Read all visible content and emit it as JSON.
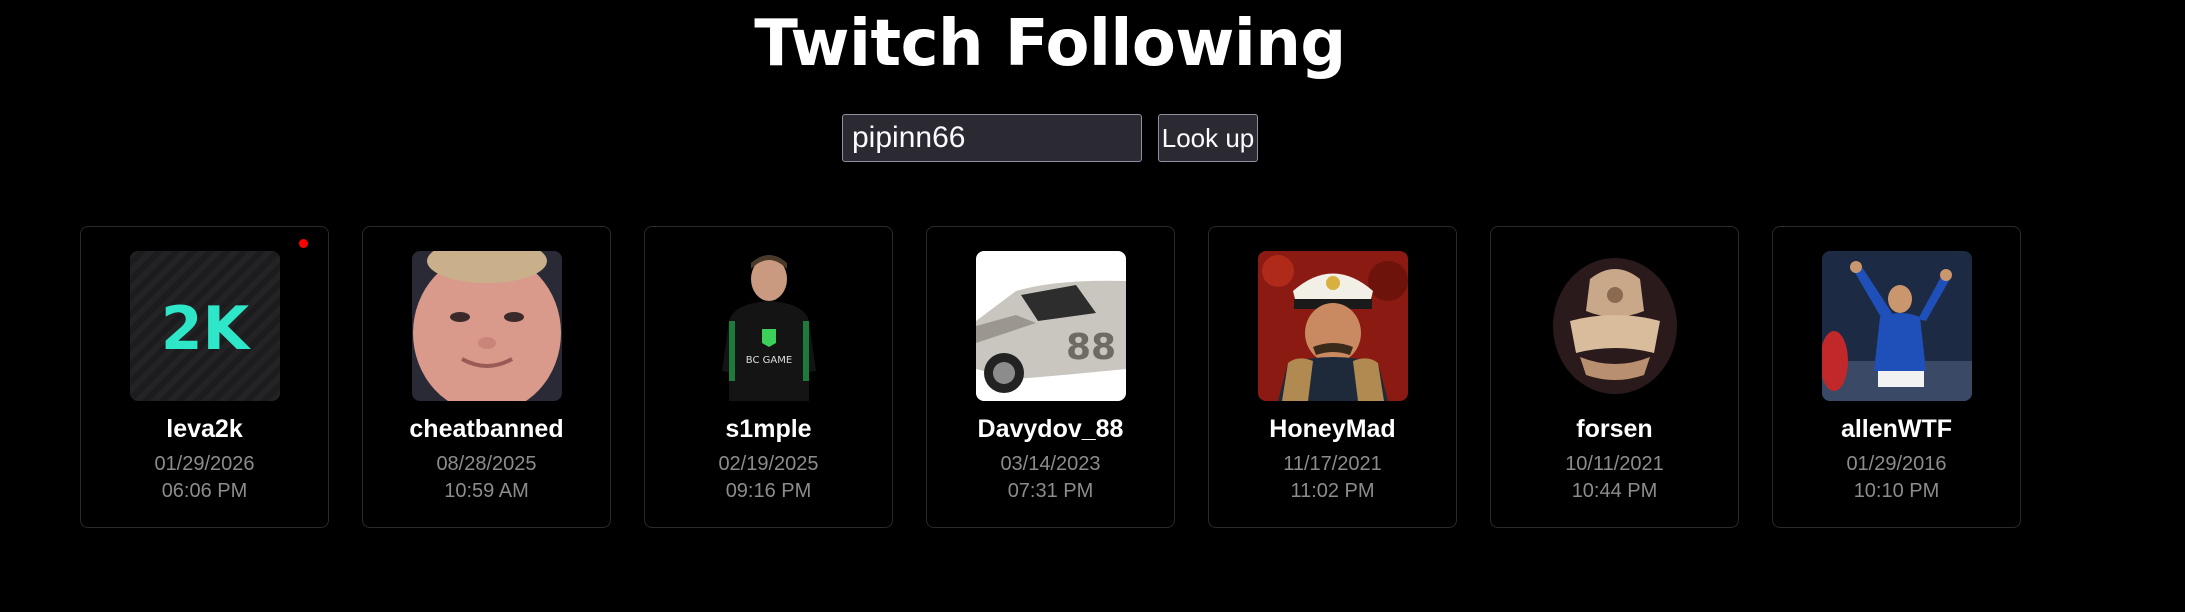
{
  "page": {
    "title": "Twitch Following"
  },
  "search": {
    "value": "pipinn66",
    "button_label": "Look up"
  },
  "colors": {
    "background": "#000000",
    "card_border": "#2a2a2a",
    "muted_text": "#8c8c8c",
    "live_indicator": "#ff0000"
  },
  "follows": [
    {
      "name": "leva2k",
      "date": "01/29/2026",
      "time": "06:06 PM",
      "live": true,
      "avatar": "leva2k-logo-avatar"
    },
    {
      "name": "cheatbanned",
      "date": "08/28/2025",
      "time": "10:59 AM",
      "live": false,
      "avatar": "face-closeup-avatar"
    },
    {
      "name": "s1mple",
      "date": "02/19/2025",
      "time": "09:16 PM",
      "live": false,
      "avatar": "player-jersey-avatar"
    },
    {
      "name": "Davydov_88",
      "date": "03/14/2023",
      "time": "07:31 PM",
      "live": false,
      "avatar": "race-car-avatar"
    },
    {
      "name": "HoneyMad",
      "date": "11/17/2021",
      "time": "11:02 PM",
      "live": false,
      "avatar": "captain-illustration-avatar"
    },
    {
      "name": "forsen",
      "date": "10/11/2021",
      "time": "10:44 PM",
      "live": false,
      "avatar": "sepia-emblem-avatar"
    },
    {
      "name": "allenWTF",
      "date": "01/29/2016",
      "time": "10:10 PM",
      "live": false,
      "avatar": "footballer-avatar"
    }
  ]
}
